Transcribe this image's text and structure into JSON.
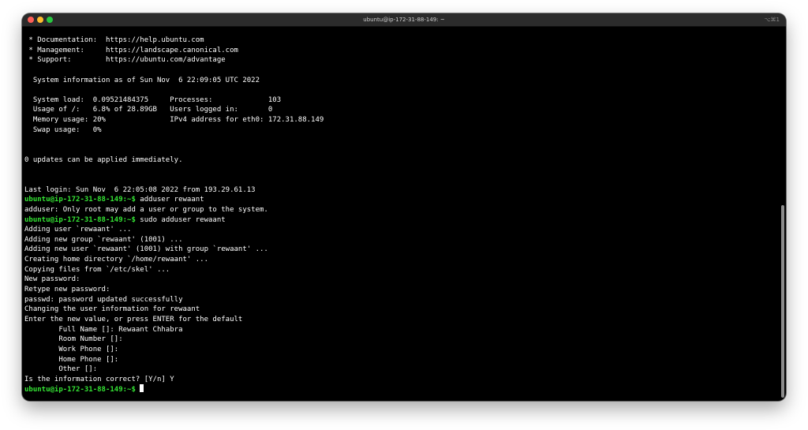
{
  "window": {
    "title": "ubuntu@ip-172-31-88-149: ~",
    "shortcut": "⌥⌘1"
  },
  "terminal": {
    "lines": [
      {
        "text": " * Documentation:  https://help.ubuntu.com"
      },
      {
        "text": " * Management:     https://landscape.canonical.com"
      },
      {
        "text": " * Support:        https://ubuntu.com/advantage"
      },
      {
        "text": ""
      },
      {
        "text": "  System information as of Sun Nov  6 22:09:05 UTC 2022"
      },
      {
        "text": ""
      },
      {
        "text": "  System load:  0.09521484375     Processes:             103"
      },
      {
        "text": "  Usage of /:   6.8% of 28.89GB   Users logged in:       0"
      },
      {
        "text": "  Memory usage: 20%               IPv4 address for eth0: 172.31.88.149"
      },
      {
        "text": "  Swap usage:   0%"
      },
      {
        "text": ""
      },
      {
        "text": ""
      },
      {
        "text": "0 updates can be applied immediately."
      },
      {
        "text": ""
      },
      {
        "text": ""
      },
      {
        "text": "Last login: Sun Nov  6 22:05:08 2022 from 193.29.61.13"
      },
      {
        "prompt": "ubuntu@ip-172-31-88-149:~$",
        "text": " adduser rewaant"
      },
      {
        "text": "adduser: Only root may add a user or group to the system."
      },
      {
        "prompt": "ubuntu@ip-172-31-88-149:~$",
        "text": " sudo adduser rewaant"
      },
      {
        "text": "Adding user `rewaant' ..."
      },
      {
        "text": "Adding new group `rewaant' (1001) ..."
      },
      {
        "text": "Adding new user `rewaant' (1001) with group `rewaant' ..."
      },
      {
        "text": "Creating home directory `/home/rewaant' ..."
      },
      {
        "text": "Copying files from `/etc/skel' ..."
      },
      {
        "text": "New password:"
      },
      {
        "text": "Retype new password:"
      },
      {
        "text": "passwd: password updated successfully"
      },
      {
        "text": "Changing the user information for rewaant"
      },
      {
        "text": "Enter the new value, or press ENTER for the default"
      },
      {
        "text": "        Full Name []: Rewaant Chhabra"
      },
      {
        "text": "        Room Number []:"
      },
      {
        "text": "        Work Phone []:"
      },
      {
        "text": "        Home Phone []:"
      },
      {
        "text": "        Other []:"
      },
      {
        "text": "Is the information correct? [Y/n] Y"
      },
      {
        "prompt": "ubuntu@ip-172-31-88-149:~$",
        "text": " ",
        "cursor": true
      }
    ]
  },
  "colors": {
    "background": "#000000",
    "foreground": "#ffffff",
    "prompt": "#34e334",
    "titlebar": "#2b2b2b"
  }
}
